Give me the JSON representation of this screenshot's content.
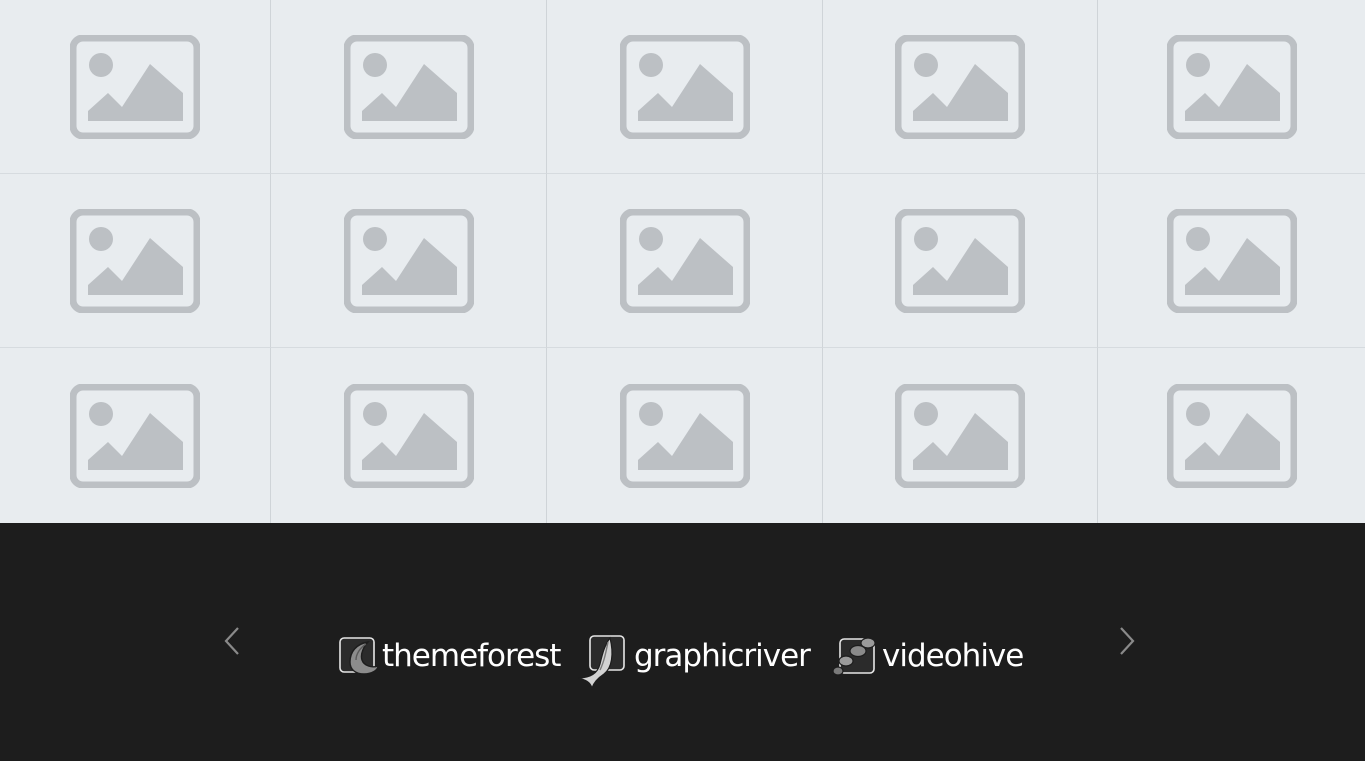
{
  "gallery": {
    "rows": 3,
    "columns": 5,
    "tiles": [
      {
        "icon": "image-placeholder-icon"
      },
      {
        "icon": "image-placeholder-icon"
      },
      {
        "icon": "image-placeholder-icon"
      },
      {
        "icon": "image-placeholder-icon"
      },
      {
        "icon": "image-placeholder-icon"
      },
      {
        "icon": "image-placeholder-icon"
      },
      {
        "icon": "image-placeholder-icon"
      },
      {
        "icon": "image-placeholder-icon"
      },
      {
        "icon": "image-placeholder-icon"
      },
      {
        "icon": "image-placeholder-icon"
      },
      {
        "icon": "image-placeholder-icon"
      },
      {
        "icon": "image-placeholder-icon"
      },
      {
        "icon": "image-placeholder-icon"
      },
      {
        "icon": "image-placeholder-icon"
      },
      {
        "icon": "image-placeholder-icon"
      }
    ],
    "background_color": "#e8ecef",
    "placeholder_color": "#bcc0c4"
  },
  "brand_carousel": {
    "background_color": "#1d1d1d",
    "prev_icon": "chevron-left-icon",
    "next_icon": "chevron-right-icon",
    "brands": [
      {
        "name": "themeforest",
        "icon": "themeforest-logo-icon"
      },
      {
        "name": "graphicriver",
        "icon": "graphicriver-logo-icon"
      },
      {
        "name": "videohive",
        "icon": "videohive-logo-icon"
      }
    ]
  }
}
